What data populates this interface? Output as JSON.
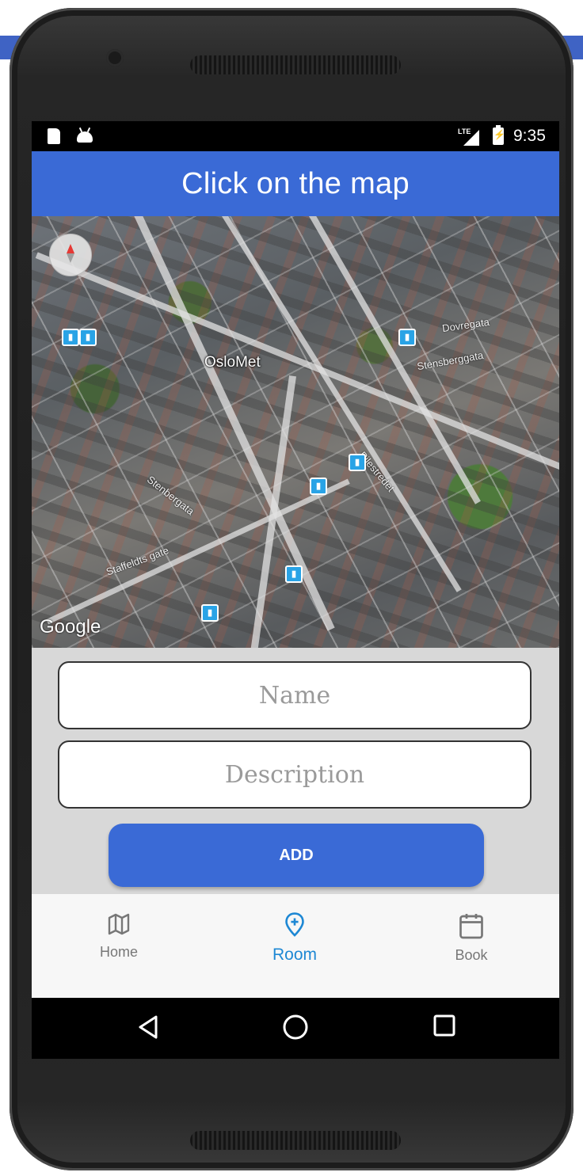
{
  "status_bar": {
    "time": "9:35",
    "network": "LTE",
    "icons": [
      "sim-card-icon",
      "android-debug-icon",
      "signal-icon",
      "battery-charging-icon"
    ]
  },
  "app_bar": {
    "title": "Click on the map"
  },
  "map": {
    "place_label": "OsloMet",
    "street_labels": [
      "Dovregata",
      "Stensberggata",
      "Pilestredet",
      "Stenbergata",
      "Staffeldts gate"
    ],
    "attribution": "Google",
    "compass_icon": "compass-icon"
  },
  "form": {
    "name_placeholder": "Name",
    "name_value": "",
    "description_placeholder": "Description",
    "description_value": "",
    "add_label": "ADD"
  },
  "bottom_nav": {
    "active": "Room",
    "accent_color": "#1e88d4",
    "items": [
      {
        "label": "Home",
        "icon": "map-icon"
      },
      {
        "label": "Room",
        "icon": "map-pin-plus-icon"
      },
      {
        "label": "Book",
        "icon": "calendar-icon"
      }
    ]
  },
  "theme": {
    "primary": "#3a6ad6"
  }
}
